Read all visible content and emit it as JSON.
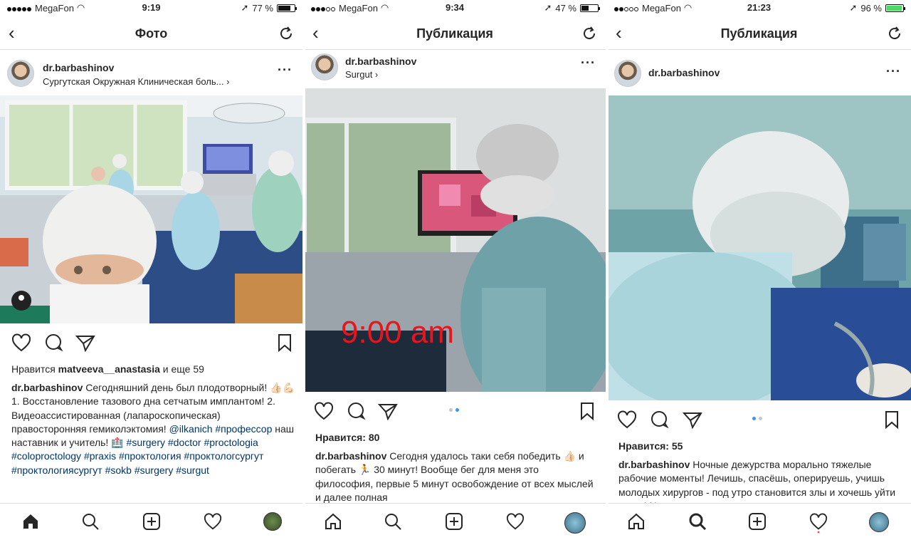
{
  "panels": [
    {
      "status": {
        "carrier": "MegaFon",
        "time": "9:19",
        "battery": "77 %"
      },
      "nav_title": "Фото",
      "username": "dr.barbashinov",
      "location": "Сургутская Окружная Клиническая боль... ›",
      "likes": {
        "prefix": "Нравится ",
        "user": "matveeva__anastasia",
        "suffix": " и еще 59"
      },
      "caption": {
        "author": "dr.barbashinov",
        "text1": " Сегодняшний день был плодотворный! 👍🏻💪🏻 1. Восстановление тазового дна сетчатым имплантом! 2. Видеоассистированная (лапароскопическая) правосторонняя гемиколэктомия! ",
        "mention": "@ilkanich",
        "text2": " ",
        "tag1": "#профессор",
        "text3": " наш наставник и учитель! 🏥 ",
        "tags": "#surgery #doctor #proctologia #coloproctology #praxis #проктология #проктологсургут #проктологиясургут #sokb #surgery #surgut"
      }
    },
    {
      "status": {
        "carrier": "MegaFon",
        "time": "9:34",
        "battery": "47 %"
      },
      "nav_title": "Публикация",
      "username": "dr.barbashinov",
      "location": "Surgut ›",
      "overlay_text": "9:00 am",
      "likes": {
        "label": "Нравится: 80"
      },
      "caption": {
        "author": "dr.barbashinov",
        "text": " Сегодня удалось таки себя победить 👍🏻 и побегать 🏃 30 минут! Вообще бег для меня это философия, первые 5 минут освобождение от всех мыслей и далее полная"
      }
    },
    {
      "status": {
        "carrier": "MegaFon",
        "time": "21:23",
        "battery": "96 %"
      },
      "nav_title": "Публикация",
      "username": "dr.barbashinov",
      "likes": {
        "label": "Нравится: 55"
      },
      "caption": {
        "author": "dr.barbashinov",
        "text": " Ночные дежурства морально тяжелые рабочие моменты! Лечишь, спасёшь, оперируешь, учишь молодых хирургов - под утро становится злы и хочешь уйти спать! Но долг и"
      }
    }
  ],
  "colors": {
    "link": "#003569",
    "accent": "#3897f0",
    "battery_full": "#4cd964",
    "overlay": "#e8141e"
  }
}
